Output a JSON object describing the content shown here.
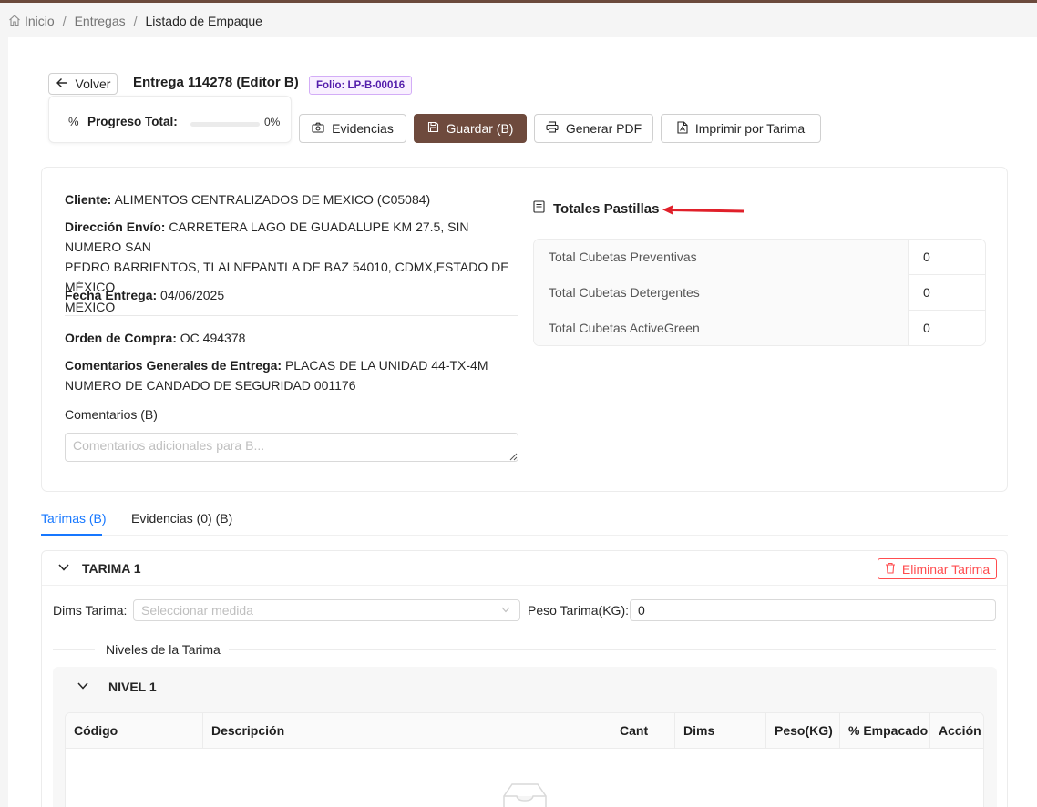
{
  "breadcrumb": {
    "home": "Inicio",
    "entregas": "Entregas",
    "current": "Listado de Empaque"
  },
  "header": {
    "back_label": "Volver",
    "title": "Entrega 114278 (Editor B)",
    "folio": "Folio: LP-B-00016"
  },
  "progress": {
    "label": "Progreso Total:",
    "value_text": "0%",
    "fraction": 0
  },
  "toolbar": {
    "evidencias": "Evidencias",
    "guardar": "Guardar (B)",
    "generar_pdf": "Generar PDF",
    "imprimir": "Imprimir por Tarima"
  },
  "info": {
    "cliente_label": "Cliente:",
    "cliente": "ALIMENTOS CENTRALIZADOS DE MEXICO (C05084)",
    "direccion_label": "Dirección Envío:",
    "direccion_line1": "CARRETERA LAGO DE GUADALUPE KM 27.5, SIN NUMERO SAN",
    "direccion_line2": "PEDRO BARRIENTOS, TLALNEPANTLA DE BAZ 54010, CDMX,ESTADO DE MÉXICO",
    "direccion_line3": "MEXICO",
    "fecha_label": "Fecha Entrega:",
    "fecha": "04/06/2025",
    "orden_label": "Orden de Compra:",
    "orden": "OC 494378",
    "comentarios_gen_label": "Comentarios Generales de Entrega:",
    "comentarios_gen_line1": "PLACAS DE LA UNIDAD 44-TX-4M",
    "comentarios_gen_line2": "NUMERO DE CANDADO DE SEGURIDAD 001176",
    "comentarios_label": "Comentarios (B)",
    "comentarios_placeholder": "Comentarios adicionales para B..."
  },
  "totales": {
    "title": "Totales Pastillas",
    "rows": [
      {
        "label": "Total Cubetas Preventivas",
        "value": "0"
      },
      {
        "label": "Total Cubetas Detergentes",
        "value": "0"
      },
      {
        "label": "Total Cubetas ActiveGreen",
        "value": "0"
      }
    ]
  },
  "tabs": [
    {
      "label": "Tarimas (B)",
      "active": true
    },
    {
      "label": "Evidencias (0) (B)",
      "active": false
    }
  ],
  "tarima": {
    "title": "TARIMA 1",
    "delete_label": "Eliminar Tarima",
    "dims_label": "Dims Tarima",
    "dims_placeholder": "Seleccionar medida",
    "peso_label": "Peso Tarima(KG)",
    "peso_value": "0",
    "niveles_label": "Niveles de la Tarima",
    "nivel": {
      "title": "NIVEL 1",
      "columns": [
        "Código",
        "Descripción",
        "Cant",
        "Dims",
        "Peso(KG)",
        "% Empacado",
        "Acción"
      ]
    }
  },
  "colors": {
    "brand": "#6e4a3d",
    "tab_active": "#1677ff",
    "danger": "#ff4d4f",
    "annotation_arrow": "#e0202a"
  }
}
